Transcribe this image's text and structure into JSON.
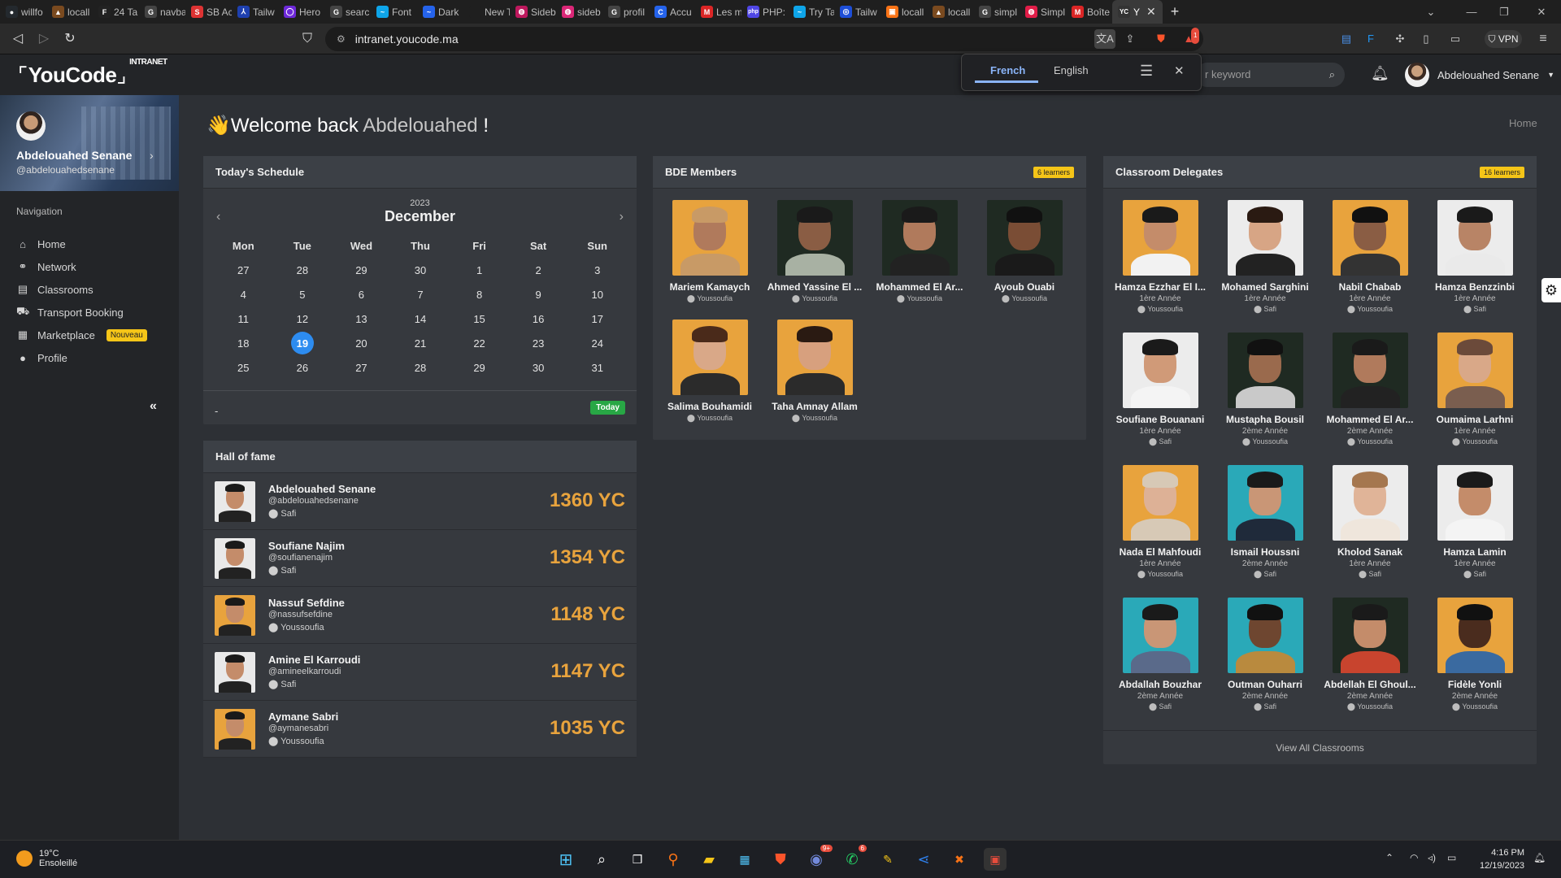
{
  "browser": {
    "tabs": [
      {
        "label": "willfo",
        "color": "#24292e",
        "glyph": "●"
      },
      {
        "label": "locall",
        "color": "#7a4a1f",
        "glyph": "▲"
      },
      {
        "label": "24 Ta",
        "color": "#222",
        "glyph": "F"
      },
      {
        "label": "navba",
        "color": "#444",
        "glyph": "G"
      },
      {
        "label": "SB Ac",
        "color": "#d33",
        "glyph": "S"
      },
      {
        "label": "Tailw",
        "color": "#1e40af",
        "glyph": "⅄"
      },
      {
        "label": "Hero",
        "color": "#6d28d9",
        "glyph": "◯"
      },
      {
        "label": "searc",
        "color": "#444",
        "glyph": "G"
      },
      {
        "label": "Font",
        "color": "#0ea5e9",
        "glyph": "~"
      },
      {
        "label": "Dark",
        "color": "#2563eb",
        "glyph": "~"
      },
      {
        "label": "New Tab",
        "color": "#1f1f1f",
        "glyph": ""
      },
      {
        "label": "Sideb",
        "color": "#be185d",
        "glyph": "◍"
      },
      {
        "label": "sideb",
        "color": "#db2777",
        "glyph": "◍"
      },
      {
        "label": "profil",
        "color": "#444",
        "glyph": "G"
      },
      {
        "label": "Accu",
        "color": "#2563eb",
        "glyph": "C"
      },
      {
        "label": "Les m",
        "color": "#dc2626",
        "glyph": "M"
      },
      {
        "label": "PHP:",
        "color": "#4f46e5",
        "glyph": "php"
      },
      {
        "label": "Try Ta",
        "color": "#0ea5e9",
        "glyph": "~"
      },
      {
        "label": "Tailw",
        "color": "#1d4ed8",
        "glyph": "◎"
      },
      {
        "label": "locall",
        "color": "#f97316",
        "glyph": "▣"
      },
      {
        "label": "locall",
        "color": "#7a4a1f",
        "glyph": "▲"
      },
      {
        "label": "simpl",
        "color": "#444",
        "glyph": "G"
      },
      {
        "label": "Simpl",
        "color": "#e11d48",
        "glyph": "◍"
      },
      {
        "label": "Boîte",
        "color": "#dc2626",
        "glyph": "M"
      }
    ],
    "active_tab": {
      "label": "Y",
      "glyph": "YC"
    },
    "url": "intranet.youcode.ma",
    "vpn_label": "VPN",
    "shield_count": "1"
  },
  "translate_popup": {
    "languages": [
      "French",
      "English"
    ],
    "selected": "French"
  },
  "header": {
    "logo": "YouCode",
    "logo_sup": "INTRANET",
    "search_placeholder": "r keyword",
    "user_name": "Abdelouahed Senane"
  },
  "sidebar": {
    "name": "Abdelouahed Senane",
    "handle": "@abdelouahedsenane",
    "nav_title": "Navigation",
    "items": [
      {
        "label": "Home",
        "icon": "home-icon"
      },
      {
        "label": "Network",
        "icon": "network-icon"
      },
      {
        "label": "Classrooms",
        "icon": "classroom-icon"
      },
      {
        "label": "Transport Booking",
        "icon": "bus-icon"
      },
      {
        "label": "Marketplace",
        "icon": "store-icon",
        "badge": "Nouveau"
      },
      {
        "label": "Profile",
        "icon": "user-icon"
      }
    ]
  },
  "welcome": {
    "prefix": "Welcome back",
    "name": "Abdelouahed",
    "suffix": "!"
  },
  "breadcrumb": "Home",
  "schedule": {
    "title": "Today's Schedule",
    "year": "2023",
    "month": "December",
    "weekdays": [
      "Mon",
      "Tue",
      "Wed",
      "Thu",
      "Fri",
      "Sat",
      "Sun"
    ],
    "days": [
      "27",
      "28",
      "29",
      "30",
      "1",
      "2",
      "3",
      "4",
      "5",
      "6",
      "7",
      "8",
      "9",
      "10",
      "11",
      "12",
      "13",
      "14",
      "15",
      "16",
      "17",
      "18",
      "19",
      "20",
      "21",
      "22",
      "23",
      "24",
      "25",
      "26",
      "27",
      "28",
      "29",
      "30",
      "31"
    ],
    "today_index": 22,
    "footer_text": "-",
    "today_label": "Today"
  },
  "hall_of_fame": {
    "title": "Hall of fame",
    "entries": [
      {
        "name": "Abdelouahed Senane",
        "handle": "@abdelouahedsenane",
        "city": "Safi",
        "score": "1360 YC",
        "bg": "#e9e9e9"
      },
      {
        "name": "Soufiane Najim",
        "handle": "@soufianenajim",
        "city": "Safi",
        "score": "1354 YC",
        "bg": "#e9e9e9"
      },
      {
        "name": "Nassuf Sefdine",
        "handle": "@nassufsefdine",
        "city": "Youssoufia",
        "score": "1148 YC",
        "bg": "#e8a33d"
      },
      {
        "name": "Amine El Karroudi",
        "handle": "@amineelkarroudi",
        "city": "Safi",
        "score": "1147 YC",
        "bg": "#e9e9e9"
      },
      {
        "name": "Aymane Sabri",
        "handle": "@aymanesabri",
        "city": "Youssoufia",
        "score": "1035 YC",
        "bg": "#e8a33d"
      }
    ]
  },
  "bde": {
    "title": "BDE Members",
    "count_label": "6 learners",
    "members": [
      {
        "name": "Mariem Kamaych",
        "city": "Youssoufia",
        "bg": "#e8a33d",
        "skin": "#b07a5c",
        "hair": "#c89a66",
        "cloth": "#c89a66"
      },
      {
        "name": "Ahmed Yassine El ...",
        "city": "Youssoufia",
        "bg": "#1f2a22",
        "skin": "#8a5d44",
        "hair": "#1a1a1a",
        "cloth": "#a8b1a3"
      },
      {
        "name": "Mohammed El Ar...",
        "city": "Youssoufia",
        "bg": "#1f2a22",
        "skin": "#b07a5c",
        "hair": "#1a1a1a",
        "cloth": "#222"
      },
      {
        "name": "Ayoub Ouabi",
        "city": "Youssoufia",
        "bg": "#1f2a22",
        "skin": "#7a4d35",
        "hair": "#111",
        "cloth": "#1a1a1a"
      },
      {
        "name": "Salima Bouhamidi",
        "city": "Youssoufia",
        "bg": "#e8a33d",
        "skin": "#d9a888",
        "hair": "#4a2a1a",
        "cloth": "#2b2b2b"
      },
      {
        "name": "Taha Amnay Allam",
        "city": "Youssoufia",
        "bg": "#e8a33d",
        "skin": "#d7a07e",
        "hair": "#2a1a12",
        "cloth": "#2b2b2b"
      }
    ]
  },
  "delegates": {
    "title": "Classroom Delegates",
    "count_label": "16 learners",
    "view_all": "View All Classrooms",
    "members": [
      {
        "name": "Hamza Ezzhar El I...",
        "year": "1ère Année",
        "city": "Youssoufia",
        "bg": "#e8a33d",
        "skin": "#c48c6a",
        "hair": "#1a1a1a",
        "cloth": "#f2f2f2"
      },
      {
        "name": "Mohamed Sarghini",
        "year": "1ère Année",
        "city": "Safi",
        "bg": "#ececec",
        "skin": "#d7a585",
        "hair": "#2a1a12",
        "cloth": "#222"
      },
      {
        "name": "Nabil Chabab",
        "year": "1ère Année",
        "city": "Youssoufia",
        "bg": "#e8a33d",
        "skin": "#8a5d44",
        "hair": "#111",
        "cloth": "#333"
      },
      {
        "name": "Hamza Benzzinbi",
        "year": "1ère Année",
        "city": "Safi",
        "bg": "#ececec",
        "skin": "#b88466",
        "hair": "#1a1a1a",
        "cloth": "#eaeaea"
      },
      {
        "name": "Soufiane Bouanani",
        "year": "1ère Année",
        "city": "Safi",
        "bg": "#ececec",
        "skin": "#d09a78",
        "hair": "#1a1a1a",
        "cloth": "#f4f4f4"
      },
      {
        "name": "Mustapha Bousil",
        "year": "2ème Année",
        "city": "Youssoufia",
        "bg": "#1f2a22",
        "skin": "#9a6a4d",
        "hair": "#111",
        "cloth": "#c9c9c9"
      },
      {
        "name": "Mohammed El Ar...",
        "year": "2ème Année",
        "city": "Youssoufia",
        "bg": "#1f2a22",
        "skin": "#b07a5c",
        "hair": "#1a1a1a",
        "cloth": "#222"
      },
      {
        "name": "Oumaima Larhni",
        "year": "1ère Année",
        "city": "Youssoufia",
        "bg": "#e8a33d",
        "skin": "#d9a888",
        "hair": "#6b4a3a",
        "cloth": "#7a5e4f"
      },
      {
        "name": "Nada El Mahfoudi",
        "year": "1ère Année",
        "city": "Youssoufia",
        "bg": "#e8a33d",
        "skin": "#ddb196",
        "hair": "#d7c9b6",
        "cloth": "#d7c9b6"
      },
      {
        "name": "Ismail Houssni",
        "year": "2ème Année",
        "city": "Safi",
        "bg": "#2aa9b8",
        "skin": "#c99676",
        "hair": "#1a1a1a",
        "cloth": "#1f2a3a"
      },
      {
        "name": "Kholod Sanak",
        "year": "1ère Année",
        "city": "Safi",
        "bg": "#ececec",
        "skin": "#e0b498",
        "hair": "#a5774f",
        "cloth": "#efe6dc"
      },
      {
        "name": "Hamza Lamin",
        "year": "1ère Année",
        "city": "Safi",
        "bg": "#ececec",
        "skin": "#c48c6a",
        "hair": "#1a1a1a",
        "cloth": "#f4f4f4"
      },
      {
        "name": "Abdallah Bouzhar",
        "year": "2ème Année",
        "city": "Safi",
        "bg": "#2aa9b8",
        "skin": "#c99676",
        "hair": "#1a1a1a",
        "cloth": "#5a6a8a"
      },
      {
        "name": "Outman Ouharri",
        "year": "2ème Année",
        "city": "Safi",
        "bg": "#2aa9b8",
        "skin": "#6e4630",
        "hair": "#111",
        "cloth": "#b98a3e"
      },
      {
        "name": "Abdellah El Ghoul...",
        "year": "2ème Année",
        "city": "Youssoufia",
        "bg": "#1f2a22",
        "skin": "#c48c6a",
        "hair": "#1a1a1a",
        "cloth": "#c8442e"
      },
      {
        "name": "Fidèle Yonli",
        "year": "2ème Année",
        "city": "Youssoufia",
        "bg": "#e8a33d",
        "skin": "#4a2c1e",
        "hair": "#111",
        "cloth": "#3a6aa0"
      }
    ]
  },
  "taskbar": {
    "temp": "19°C",
    "weather": "Ensoleillé",
    "time": "4:16 PM",
    "date": "12/19/2023",
    "discord_badge": "9+",
    "whatsapp_badge": "6"
  }
}
